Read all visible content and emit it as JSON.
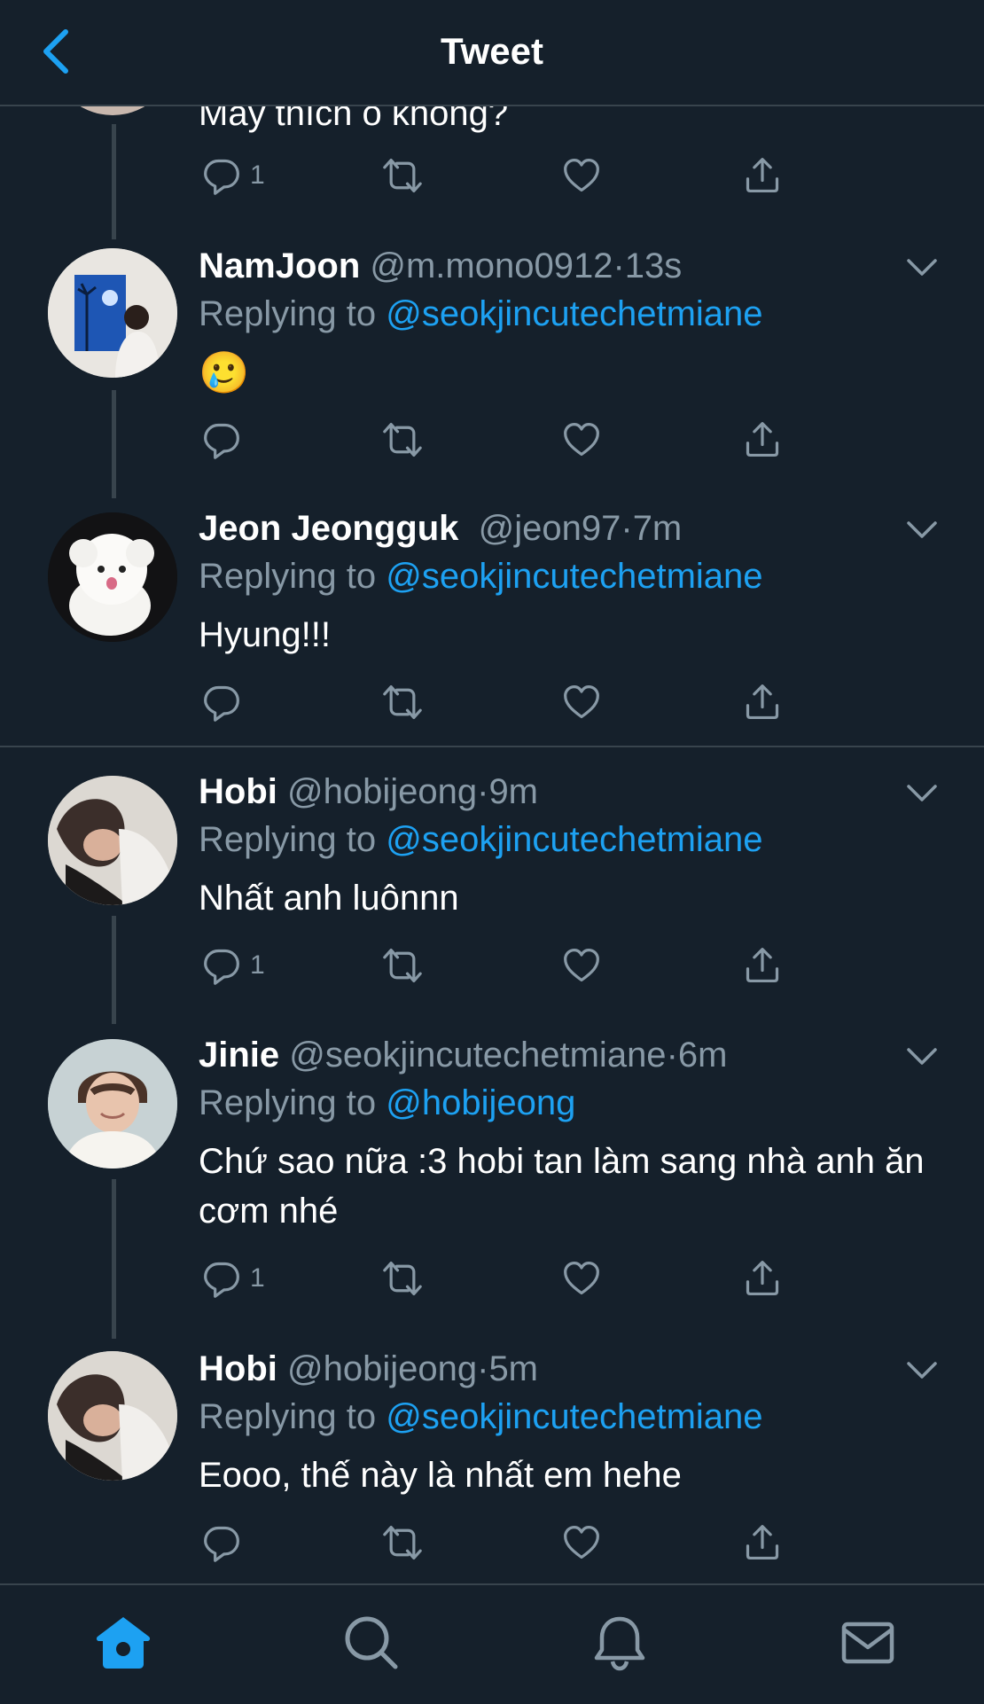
{
  "header": {
    "title": "Tweet"
  },
  "top_partial": {
    "text": "Mày thích ò không?",
    "reply_count": "1"
  },
  "tweets": [
    {
      "name": "NamJoon",
      "handle": "@m.mono0912",
      "separator": "·",
      "time": "13s",
      "replying_prefix": "Replying to",
      "replying_to": "@seokjincutechetmiane",
      "text": "🥲",
      "reply_count": ""
    },
    {
      "name": "Jeon Jeongguk",
      "handle": "@jeon97",
      "separator": "·",
      "time": "7m",
      "replying_prefix": "Replying to",
      "replying_to": "@seokjincutechetmiane",
      "text": "Hyung!!!",
      "reply_count": ""
    },
    {
      "name": "Hobi",
      "handle": "@hobijeong",
      "separator": "·",
      "time": "9m",
      "replying_prefix": "Replying to",
      "replying_to": "@seokjincutechetmiane",
      "text": "Nhất anh luônnn",
      "reply_count": "1"
    },
    {
      "name": "Jinie",
      "handle": "@seokjincutechetmiane",
      "separator": "·",
      "time": "6m",
      "replying_prefix": "Replying to",
      "replying_to": "@hobijeong",
      "text": "Chứ sao nữa :3 hobi tan làm sang nhà anh ăn cơm nhé",
      "reply_count": "1"
    },
    {
      "name": "Hobi",
      "handle": "@hobijeong",
      "separator": "·",
      "time": "5m",
      "replying_prefix": "Replying to",
      "replying_to": "@seokjincutechetmiane",
      "text": "Eooo, thế này là nhất em hehe",
      "reply_count": ""
    }
  ],
  "icons": {
    "back": "chevron-left-icon",
    "caret": "chevron-down-icon",
    "reply": "reply-icon",
    "retweet": "retweet-icon",
    "like": "heart-icon",
    "share": "share-icon",
    "home": "home-icon",
    "search": "search-icon",
    "notifications": "bell-icon",
    "messages": "mail-icon"
  },
  "colors": {
    "background": "#15202b",
    "accent": "#1da1f2",
    "muted": "#8899a6",
    "divider": "#38444d"
  }
}
